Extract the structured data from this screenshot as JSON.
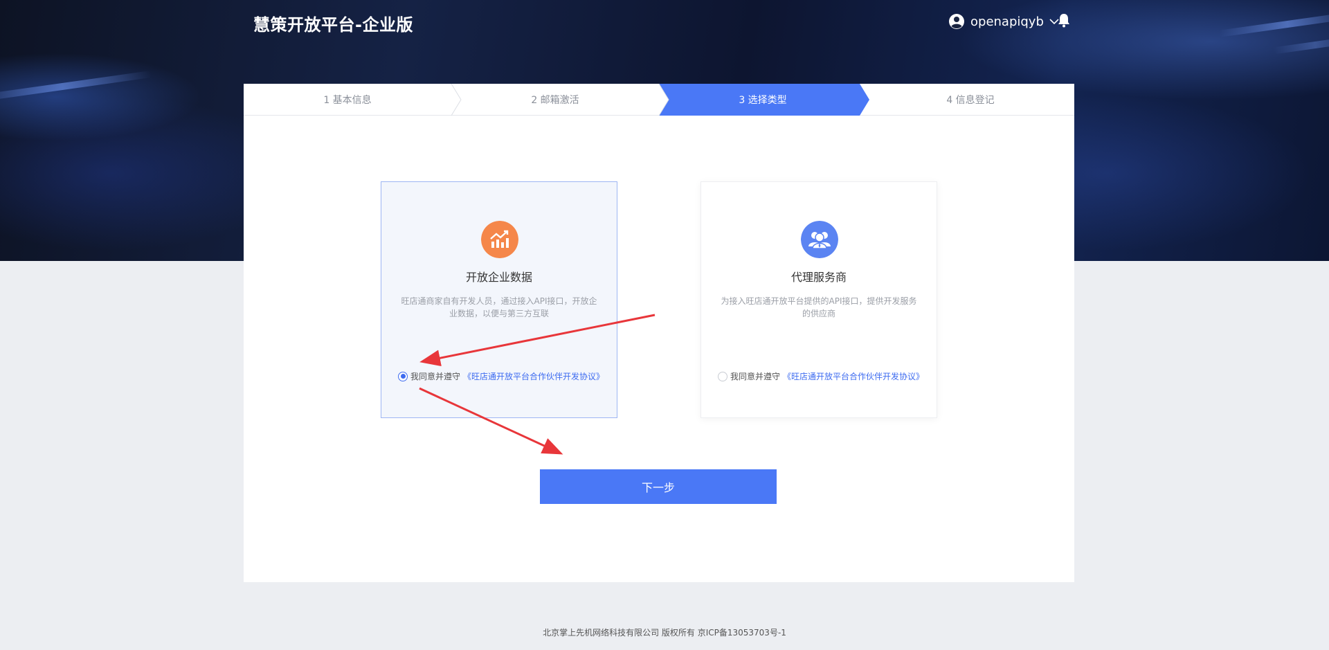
{
  "header": {
    "brand": "慧策开放平台-企业版",
    "username": "openapiqyb"
  },
  "steps": [
    {
      "label": "1 基本信息",
      "active": false
    },
    {
      "label": "2 邮箱激活",
      "active": false
    },
    {
      "label": "3 选择类型",
      "active": true
    },
    {
      "label": "4 信息登记",
      "active": false
    }
  ],
  "options": [
    {
      "title": "开放企业数据",
      "description": "旺店通商家自有开发人员，通过接入API接口，开放企业数据，以便与第三方互联",
      "agree_text": "我同意并遵守",
      "agreement_link": "《旺店通开放平台合作伙伴开发协议》",
      "selected": true,
      "icon": "chart-growth-icon",
      "icon_color": "#f5874a"
    },
    {
      "title": "代理服务商",
      "description": "为接入旺店通开放平台提供的API接口，提供开发服务的供应商",
      "agree_text": "我同意并遵守",
      "agreement_link": "《旺店通开放平台合作伙伴开发协议》",
      "selected": false,
      "icon": "service-people-icon",
      "icon_color": "#5b84f2"
    }
  ],
  "next_button": "下一步",
  "footer": "北京掌上先机网络科技有限公司 版权所有 京ICP备13053703号-1",
  "colors": {
    "accent": "#4a78f6",
    "step_active": "#4a78f6",
    "annotation_arrow": "#e8363a"
  }
}
